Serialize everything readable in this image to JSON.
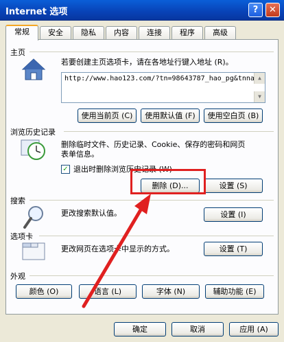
{
  "window": {
    "title": "Internet 选项",
    "help_glyph": "?",
    "close_glyph": "✕"
  },
  "tabs": [
    {
      "label": "常规"
    },
    {
      "label": "安全"
    },
    {
      "label": "隐私"
    },
    {
      "label": "内容"
    },
    {
      "label": "连接"
    },
    {
      "label": "程序"
    },
    {
      "label": "高级"
    }
  ],
  "homepage": {
    "heading": "主页",
    "description": "若要创建主页选项卡，请在各地址行键入地址 (R)。",
    "url": "http://www.hao123.com/?tn=98643787_hao_pg&tnna",
    "buttons": {
      "use_current": "使用当前页 (C)",
      "use_default": "使用默认值 (F)",
      "use_blank": "使用空白页 (B)"
    }
  },
  "history": {
    "heading": "浏览历史记录",
    "description_line1": "删除临时文件、历史记录、Cookie、保存的密码和网页",
    "description_line2": "表单信息。",
    "checkbox_label": "退出时删除浏览历史记录 (W)",
    "checkbox_checked": true,
    "checkbox_glyph": "✓",
    "delete_button": "删除 (D)...",
    "settings_button": "设置 (S)"
  },
  "search": {
    "heading": "搜索",
    "description": "更改搜索默认值。",
    "settings_button": "设置 (I)"
  },
  "tabs_section": {
    "heading": "选项卡",
    "description": "更改网页在选项卡中显示的方式。",
    "settings_button": "设置 (T)"
  },
  "appearance": {
    "heading": "外观",
    "buttons": {
      "colors": "颜色 (O)",
      "languages": "语言 (L)",
      "fonts": "字体 (N)",
      "accessibility": "辅助功能 (E)"
    }
  },
  "footer": {
    "ok": "确定",
    "cancel": "取消",
    "apply": "应用 (A)"
  },
  "colors": {
    "annotation": "#e02020",
    "titlebar": "#0842b6"
  }
}
